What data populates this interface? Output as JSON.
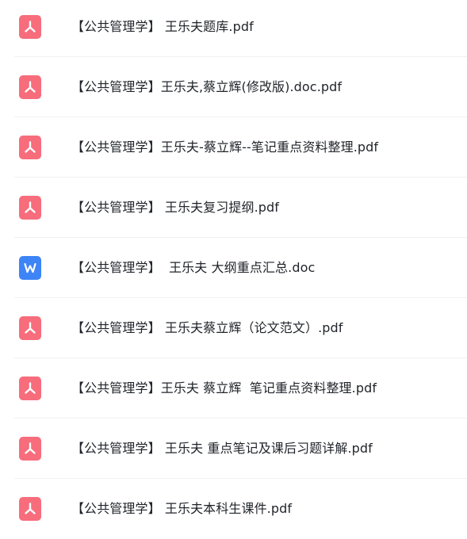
{
  "colors": {
    "pdf_icon": "#f76d7c",
    "word_icon": "#3d84f7",
    "text": "#1f2329",
    "divider": "#eff0f2"
  },
  "files": [
    {
      "name": "【公共管理学】 王乐夫题库.pdf",
      "type": "pdf",
      "icon": "pdf-icon"
    },
    {
      "name": "【公共管理学】王乐夫,蔡立辉(修改版).doc.pdf",
      "type": "pdf",
      "icon": "pdf-icon"
    },
    {
      "name": "【公共管理学】王乐夫-蔡立辉--笔记重点资料整理.pdf",
      "type": "pdf",
      "icon": "pdf-icon"
    },
    {
      "name": "【公共管理学】 王乐夫复习提纲.pdf",
      "type": "pdf",
      "icon": "pdf-icon"
    },
    {
      "name": "【公共管理学】  王乐夫 大纲重点汇总.doc",
      "type": "doc",
      "icon": "word-icon"
    },
    {
      "name": "【公共管理学】 王乐夫蔡立辉（论文范文）.pdf",
      "type": "pdf",
      "icon": "pdf-icon"
    },
    {
      "name": "【公共管理学】王乐夫 蔡立辉  笔记重点资料整理.pdf",
      "type": "pdf",
      "icon": "pdf-icon"
    },
    {
      "name": "【公共管理学】 王乐夫 重点笔记及课后习题详解.pdf",
      "type": "pdf",
      "icon": "pdf-icon"
    },
    {
      "name": "【公共管理学】 王乐夫本科生课件.pdf",
      "type": "pdf",
      "icon": "pdf-icon"
    }
  ]
}
